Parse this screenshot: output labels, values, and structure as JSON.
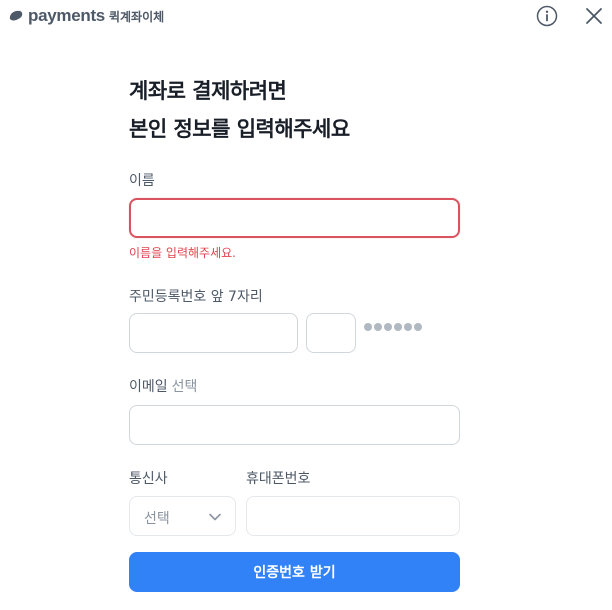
{
  "header": {
    "logo_text": "payments",
    "logo_sub": "퀵계좌이체",
    "info_icon": "info-circle-icon",
    "close_icon": "close-icon"
  },
  "title": {
    "line1": "계좌로 결제하려면",
    "line2": "본인 정보를 입력해주세요"
  },
  "form": {
    "name": {
      "label": "이름",
      "value": "",
      "error": "이름을 입력해주세요."
    },
    "rrn": {
      "label": "주민등록번호 앞 7자리",
      "front_value": "",
      "back_value": "",
      "masked_count": 6
    },
    "email": {
      "label": "이메일",
      "optional": "선택",
      "value": ""
    },
    "carrier": {
      "label": "통신사",
      "selected": "선택"
    },
    "phone": {
      "label": "휴대폰번호",
      "value": ""
    },
    "submit_label": "인증번호 받기"
  },
  "colors": {
    "primary": "#3182f6",
    "error": "#e0444f",
    "border": "#d1d6db",
    "text": "#191f28",
    "subtext": "#4e5968"
  }
}
